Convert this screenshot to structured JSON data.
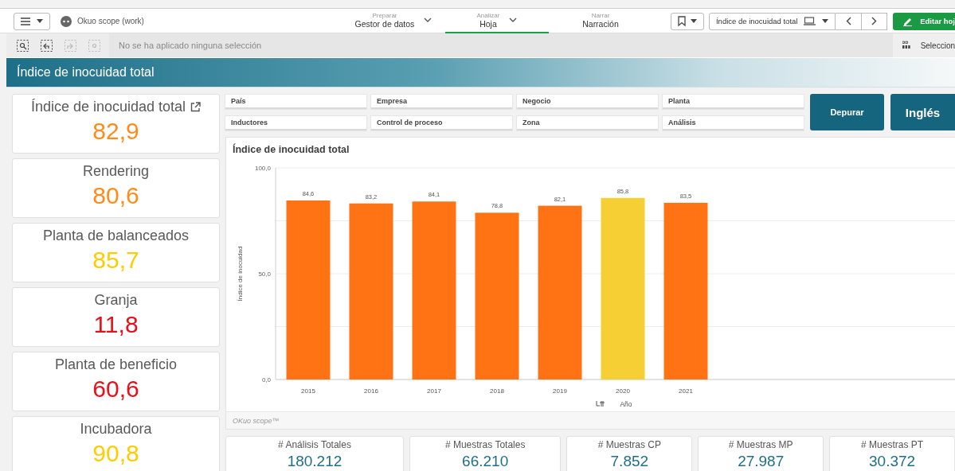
{
  "toolbar": {
    "app_name": "Okuo scope (work)",
    "nav": [
      {
        "caption": "Preparar",
        "label": "Gestor de datos",
        "menu": true,
        "selected": false
      },
      {
        "caption": "Analizar",
        "label": "Hoja",
        "menu": true,
        "selected": true
      },
      {
        "caption": "Narrar",
        "label": "Narración",
        "menu": false,
        "selected": false
      }
    ],
    "sheet_selector": "Índice de inocuidad total",
    "edit_button": "Editar hoj"
  },
  "selection_bar": {
    "tools": [
      {
        "kind": "search",
        "disabled": false
      },
      {
        "kind": "back",
        "disabled": false
      },
      {
        "kind": "forward",
        "disabled": true
      },
      {
        "kind": "clear",
        "disabled": true
      }
    ],
    "message": "No se ha aplicado ninguna selección",
    "selections_label": "Seleccion"
  },
  "sheet_title": "Índice de inocuidad total",
  "kpis": [
    {
      "label": "Índice de inocuidad total",
      "value": "82,9",
      "color": "#ff8c1a",
      "link": true
    },
    {
      "label": "Rendering",
      "value": "80,6",
      "color": "#ff8c1a",
      "link": false
    },
    {
      "label": "Planta de balanceados",
      "value": "85,7",
      "color": "#ffcc00",
      "link": false
    },
    {
      "label": "Granja",
      "value": "11,8",
      "color": "#e8101a",
      "link": false
    },
    {
      "label": "Planta de beneficio",
      "value": "60,6",
      "color": "#e8101a",
      "link": false
    },
    {
      "label": "Incubadora",
      "value": "90,8",
      "color": "#ffcc00",
      "link": false
    }
  ],
  "filters": [
    "País",
    "Empresa",
    "Negocio",
    "Planta",
    "Inductores",
    "Control de proceso",
    "Zona",
    "Análisis"
  ],
  "buttons": [
    {
      "label": "Depurar",
      "kind": "action"
    },
    {
      "label": "Inglés",
      "kind": "language"
    }
  ],
  "chart": {
    "title": "Índice de inocuidad total",
    "footer": "OKuo scope™",
    "chart_data": {
      "type": "bar",
      "ylabel": "Índice de inocuidad",
      "xlabel": "Año",
      "categories": [
        "2015",
        "2016",
        "2017",
        "2018",
        "2019",
        "2020",
        "2021"
      ],
      "values": [
        84.6,
        83.2,
        84.1,
        78.8,
        82.1,
        85.8,
        83.5
      ],
      "colors": [
        "#ff7315",
        "#ff7315",
        "#ff7315",
        "#ff7315",
        "#ff7315",
        "#f5cf33",
        "#ff7315"
      ],
      "value_labels": [
        "84,6",
        "83,2",
        "84,1",
        "78,8",
        "82,1",
        "85,8",
        "83,5"
      ],
      "ylim": [
        0,
        100
      ],
      "yticks": [
        {
          "value": 0,
          "label": "0,0"
        },
        {
          "value": 50,
          "label": "50,0"
        },
        {
          "value": 100,
          "label": "100,0"
        }
      ]
    }
  },
  "stats": [
    {
      "label": "# Análisis Totales",
      "value": "180.212"
    },
    {
      "label": "# Muestras Totales",
      "value": "66.210"
    },
    {
      "label": "# Muestras CP",
      "value": "7.852"
    },
    {
      "label": "# Muestras MP",
      "value": "27.987"
    },
    {
      "label": "# Muestras PT",
      "value": "30.372"
    }
  ]
}
